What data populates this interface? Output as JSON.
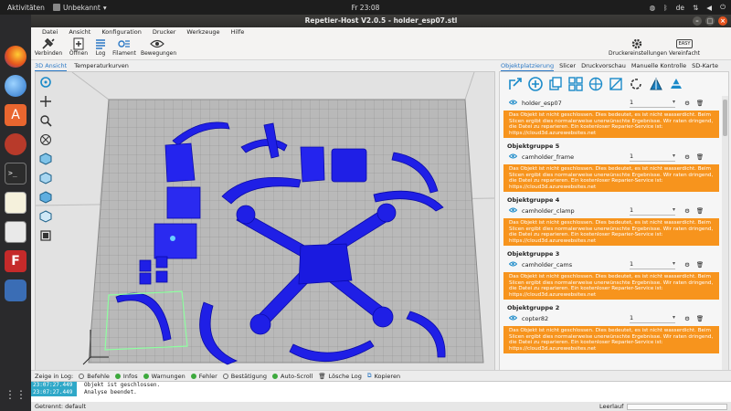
{
  "os": {
    "activities": "Aktivitäten",
    "app_menu": "Unbekannt",
    "clock": "Fr 23:08",
    "lang": "de"
  },
  "window": {
    "title": "Repetier-Host V2.0.5 - holder_esp07.stl",
    "menu": [
      "Datei",
      "Ansicht",
      "Konfiguration",
      "Drucker",
      "Werkzeuge",
      "Hilfe"
    ]
  },
  "toolbar": {
    "connect": "Verbinden",
    "open": "Öffnen",
    "log": "Log",
    "filament": "Filament",
    "moves": "Bewegungen",
    "printer_settings": "Druckereinstellungen",
    "easy_badge": "EASY",
    "simplified": "Vereinfacht"
  },
  "view_tabs": [
    "3D Ansicht",
    "Temperaturkurven"
  ],
  "right_tabs": [
    "Objektplatzierung",
    "Slicer",
    "Druckvorschau",
    "Manuelle Kontrolle",
    "SD-Karte"
  ],
  "objects": {
    "warning_text": "Das Objekt ist nicht geschlossen. Dies bedeutet, es ist nicht wasserdicht. Beim Slicen ergibt dies normalerweise unerwünschte Ergebnisse. Wir raten dringend, die Datei zu reparieren. Ein kostenloser Reparier-Service ist: https://cloud3d.azurewebsites.net",
    "first_item": {
      "name": "holder_esp07",
      "qty": "1"
    },
    "groups": [
      {
        "title": "Objektgruppe 5",
        "name": "camholder_frame",
        "qty": "1"
      },
      {
        "title": "Objektgruppe 4",
        "name": "camholder_clamp",
        "qty": "1"
      },
      {
        "title": "Objektgruppe 3",
        "name": "camholder_cams",
        "qty": "1"
      },
      {
        "title": "Objektgruppe 2",
        "name": "copter82",
        "qty": "1"
      }
    ]
  },
  "log": {
    "show_label": "Zeige in Log:",
    "options": [
      {
        "label": "Befehle",
        "on": false
      },
      {
        "label": "Infos",
        "on": true
      },
      {
        "label": "Warnungen",
        "on": true
      },
      {
        "label": "Fehler",
        "on": true
      },
      {
        "label": "Bestätigung",
        "on": false
      },
      {
        "label": "Auto-Scroll",
        "on": true
      }
    ],
    "clear": "Lösche Log",
    "copy": "Kopieren",
    "lines": [
      {
        "time": "23:07:27.449",
        "msg": "Objekt ist geschlossen."
      },
      {
        "time": "23:07:27.449",
        "msg": "Analyse beendet."
      }
    ]
  },
  "status": {
    "left": "Getrennt: default",
    "idle": "Leerlauf"
  },
  "colors": {
    "model_blue": "#1f1fe6",
    "warning_orange": "#f7941d",
    "accent_blue": "#2b78c5"
  }
}
